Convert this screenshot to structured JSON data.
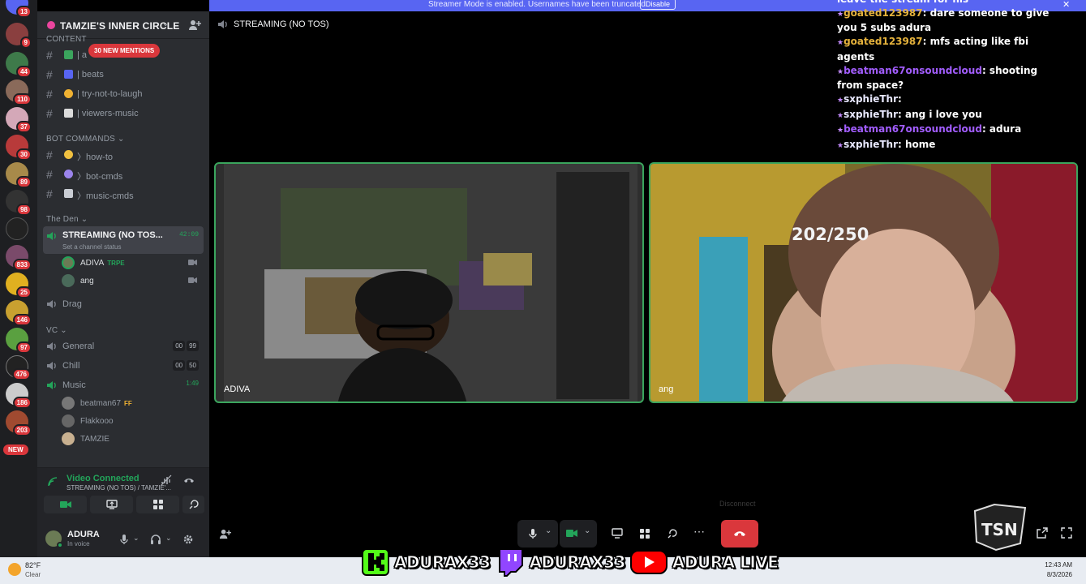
{
  "banner": {
    "text": "Streamer Mode is enabled. Usernames have been truncated.",
    "button": "Disable"
  },
  "rail": {
    "badges": [
      "13",
      "9",
      "44",
      "110",
      "37",
      "30",
      "89",
      "98",
      "833",
      "25",
      "146",
      "97",
      "476",
      "186",
      "203"
    ],
    "new_label": "NEW"
  },
  "server": {
    "name": "TAMZIE'S INNER CIRCLE",
    "mentions": "30 NEW MENTIONS",
    "partial_category": "CONTENT"
  },
  "channels_top": [
    {
      "label": "| a"
    },
    {
      "label": "| beats"
    },
    {
      "label": "| try-not-to-laugh"
    },
    {
      "label": "| viewers-music"
    }
  ],
  "bot_category": "BOT COMMANDS",
  "channels_bot": [
    {
      "label": "〉how-to"
    },
    {
      "label": "〉bot-cmds"
    },
    {
      "label": "〉music-cmds"
    }
  ],
  "den_category": "The Den",
  "active_channel": {
    "name": "STREAMING (NO TOS...",
    "time": "42:09",
    "status": "Set a channel status"
  },
  "voice_users_active": [
    {
      "name": "ADIVA",
      "tag": "TRPE"
    },
    {
      "name": "ang",
      "tag": ""
    }
  ],
  "drag_channel": "Drag",
  "vc_category": "VC",
  "vc_channels": [
    {
      "name": "General",
      "count_a": "00",
      "count_b": "99"
    },
    {
      "name": "Chill",
      "count_a": "00",
      "count_b": "50"
    },
    {
      "name": "Music",
      "time": "1:49"
    }
  ],
  "music_users": [
    {
      "name": "beatman67",
      "tag": "FF"
    },
    {
      "name": "Flakkooo",
      "tag": ""
    },
    {
      "name": "TAMZIE",
      "tag": ""
    }
  ],
  "voice_panel": {
    "title": "Video Connected",
    "sub": "STREAMING (NO TOS) / TAMZIE'..."
  },
  "user": {
    "name": "ADURA",
    "status": "In voice"
  },
  "stage": {
    "title": "STREAMING (NO TOS)",
    "tile1_label": "ADIVA",
    "tile2_label": "ang",
    "counter": "202/250",
    "disconnect_tip": "Disconnect"
  },
  "chat": [
    {
      "user": "",
      "text": "leave the stream for his",
      "color": "u3"
    },
    {
      "user": "goated123987",
      "text": "dare someone to give you 5 subs adura",
      "color": "u1"
    },
    {
      "user": "goated123987",
      "text": "mfs acting like fbi agents",
      "color": "u1"
    },
    {
      "user": "beatman67onsoundcloud",
      "text": "shooting from space?",
      "color": "u2"
    },
    {
      "user": "sxphieThr",
      "text": "",
      "color": "u3"
    },
    {
      "user": "sxphieThr",
      "text": "ang i love you",
      "color": "u3"
    },
    {
      "user": "beatman67onsoundcloud",
      "text": "adura",
      "color": "u2"
    },
    {
      "user": "sxphieThr",
      "text": "home",
      "color": "u3"
    }
  ],
  "socials": [
    {
      "icon": "kick-icon",
      "handle": "ADURAX33",
      "color": "#53fc18"
    },
    {
      "icon": "twitch-icon",
      "handle": "ADURAX33",
      "color": "#9146ff"
    },
    {
      "icon": "youtube-icon",
      "handle": "ADURA LIVE",
      "color": "#ff0000"
    }
  ],
  "taskbar": {
    "temp": "82°F",
    "weather": "Clear",
    "time": "12:43 AM",
    "date": "8/3/2026"
  }
}
